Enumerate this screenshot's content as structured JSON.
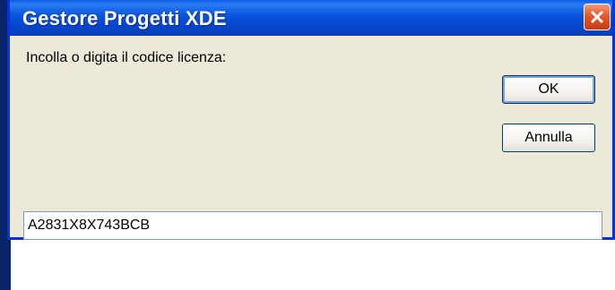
{
  "dialog": {
    "title": "Gestore Progetti XDE",
    "prompt": "Incolla o digita il codice licenza:",
    "ok_label": "OK",
    "cancel_label": "Annulla",
    "license_value": "A2831X8X743BCB"
  },
  "icons": {
    "close": "close-icon"
  },
  "colors": {
    "titlebar": "#0a57df",
    "dialog_background": "#ece9d8",
    "close_button": "#e45a2c"
  }
}
